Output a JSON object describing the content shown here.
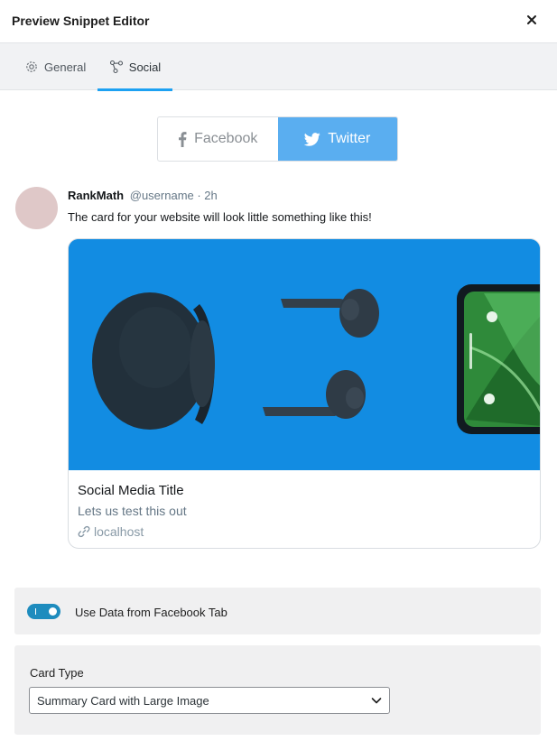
{
  "header": {
    "title": "Preview Snippet Editor",
    "close_icon": "close-icon"
  },
  "tabs": [
    {
      "label": "General",
      "icon": "gear-icon",
      "active": false
    },
    {
      "label": "Social",
      "icon": "share-icon",
      "active": true
    }
  ],
  "network_toggle": {
    "facebook_label": "Facebook",
    "twitter_label": "Twitter",
    "selected": "Twitter"
  },
  "tweet": {
    "name": "RankMath",
    "meta": "@username · 2h",
    "text": "The card for your website will look little something like this!"
  },
  "card": {
    "title": "Social Media Title",
    "description": "Lets us test this out",
    "url": "localhost"
  },
  "use_facebook_data": {
    "label": "Use Data from Facebook Tab",
    "enabled": true
  },
  "card_type": {
    "label": "Card Type",
    "value": "Summary Card with Large Image"
  },
  "colors": {
    "accent": "#1da1f2",
    "twitter_button": "#5aaef0",
    "toggle_on": "#1e8cbe",
    "image_background": "#1391e6"
  }
}
